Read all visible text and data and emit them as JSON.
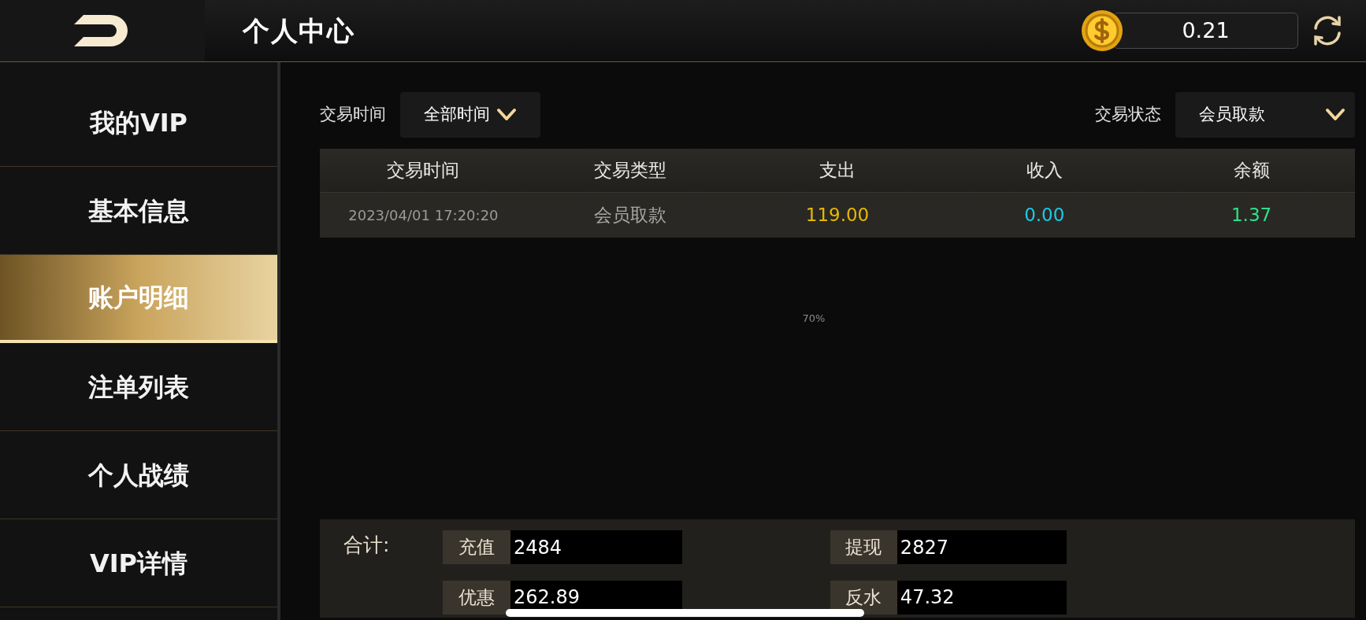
{
  "header": {
    "title": "个人中心",
    "balance": "0.21"
  },
  "sidebar": {
    "items": [
      {
        "label": "我的VIP",
        "selected": false
      },
      {
        "label": "基本信息",
        "selected": false
      },
      {
        "label": "账户明细",
        "selected": true
      },
      {
        "label": "注单列表",
        "selected": false
      },
      {
        "label": "个人战绩",
        "selected": false
      },
      {
        "label": "VIP详情",
        "selected": false
      }
    ]
  },
  "filters": [
    {
      "label": "交易时间",
      "value": "全部时间"
    },
    {
      "label": "交易状态",
      "value": "会员取款"
    }
  ],
  "table": {
    "columns": [
      "交易时间",
      "交易类型",
      "支出",
      "收入",
      "余额"
    ],
    "rows": [
      {
        "cells": [
          "2023/04/01 17:20:20",
          "会员取款",
          "119.00",
          "0.00",
          "1.37"
        ]
      }
    ]
  },
  "loading_text": "70%",
  "totals": {
    "label": "合计:",
    "items": [
      {
        "label": "充值",
        "value": "2484"
      },
      {
        "label": "提现",
        "value": "2827"
      },
      {
        "label": "优惠",
        "value": "262.89"
      },
      {
        "label": "反水",
        "value": "47.32"
      }
    ]
  }
}
